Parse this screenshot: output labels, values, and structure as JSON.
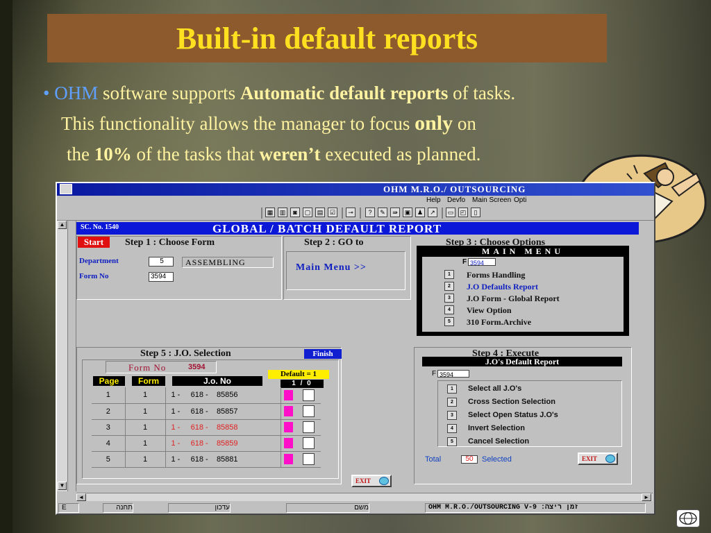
{
  "slide": {
    "title": "Built-in default reports",
    "line1": {
      "bullet": "•",
      "ohm": "OHM",
      "t1": " software supports ",
      "bold": "Automatic default reports",
      "t2": " of tasks."
    },
    "line2": {
      "t1": "This functionality allows the manager to focus ",
      "bold": "only",
      "t2": " on"
    },
    "line3": {
      "t1": "the ",
      "bold1": "10%",
      "t2": " of the tasks that ",
      "bold2": "weren’t",
      "t3": " executed as planned."
    }
  },
  "app": {
    "title": "OHM   M.R.O./ OUTSOURCING",
    "menu": [
      "Help",
      "Devfo",
      "Main Screen",
      "Opti"
    ],
    "form_header": {
      "sc_no": "SC. No. 1540",
      "title": "GLOBAL / BATCH  DEFAULT REPORT"
    },
    "step1": {
      "start": "Start",
      "title": "Step 1 : Choose Form",
      "department_label": "Department",
      "department_value": "5",
      "department_name": "ASSEMBLING",
      "formno_label": "Form No",
      "formno_value": "3594"
    },
    "step2": {
      "title": "Step 2 : GO to",
      "link": "Main Menu  >>"
    },
    "step3": {
      "title": "Step 3 : Choose Options",
      "menu_title": "MAIN     MENU",
      "f_label": "F",
      "f_value": "3594",
      "items": [
        {
          "num": "1",
          "label": "Forms Handling"
        },
        {
          "num": "2",
          "label": "J.O Defaults Report"
        },
        {
          "num": "3",
          "label": "J.O Form  - Global Report"
        },
        {
          "num": "4",
          "label": "View Option"
        },
        {
          "num": "5",
          "label": "310 Form.Archive"
        }
      ]
    },
    "step5": {
      "title": "Step 5 : J.O. Selection",
      "finish": "Finish",
      "formno_label": "Form No",
      "formno_value": "3594",
      "default_label": "Default = 1",
      "ratio": "1 / 0",
      "columns": [
        "Page",
        "Form",
        "J.o. No"
      ],
      "rows": [
        {
          "page": "1",
          "form": "1",
          "a": "1 -",
          "b": "618 -",
          "c": "85856",
          "red": false
        },
        {
          "page": "2",
          "form": "1",
          "a": "1 -",
          "b": "618 -",
          "c": "85857",
          "red": false
        },
        {
          "page": "3",
          "form": "1",
          "a": "1 -",
          "b": "618 -",
          "c": "85858",
          "red": true
        },
        {
          "page": "4",
          "form": "1",
          "a": "1 -",
          "b": "618 -",
          "c": "85859",
          "red": true
        },
        {
          "page": "5",
          "form": "1",
          "a": "1 -",
          "b": "618 -",
          "c": "85881",
          "red": false
        }
      ],
      "exit": "EXIT"
    },
    "step4": {
      "title": "Step 4 : Execute",
      "report_title": "J.O's Default Report",
      "f_label": "F",
      "f_value": "3594",
      "items": [
        {
          "num": "1",
          "label": "Select all J.O's"
        },
        {
          "num": "2",
          "label": "Cross Section Selection"
        },
        {
          "num": "3",
          "label": "Select Open Status J.O's"
        },
        {
          "num": "4",
          "label": "Invert Selection"
        },
        {
          "num": "5",
          "label": "Cancel Selection"
        }
      ],
      "total_label": "Total",
      "total_value": "50",
      "selected_label": "Selected",
      "exit": "EXIT"
    },
    "status": {
      "c1": "E",
      "c2": "תחנה",
      "c3": "עדכון",
      "c4": "משם",
      "c5": "OHM  M.R.O./OUTSOURCING  V-9 :זמן ריצה"
    }
  },
  "colors": {
    "title_bg": "#8c5a2d",
    "title_text": "#ffe020",
    "body_text": "#fff2a0",
    "accent_blue": "#0b18d8"
  }
}
